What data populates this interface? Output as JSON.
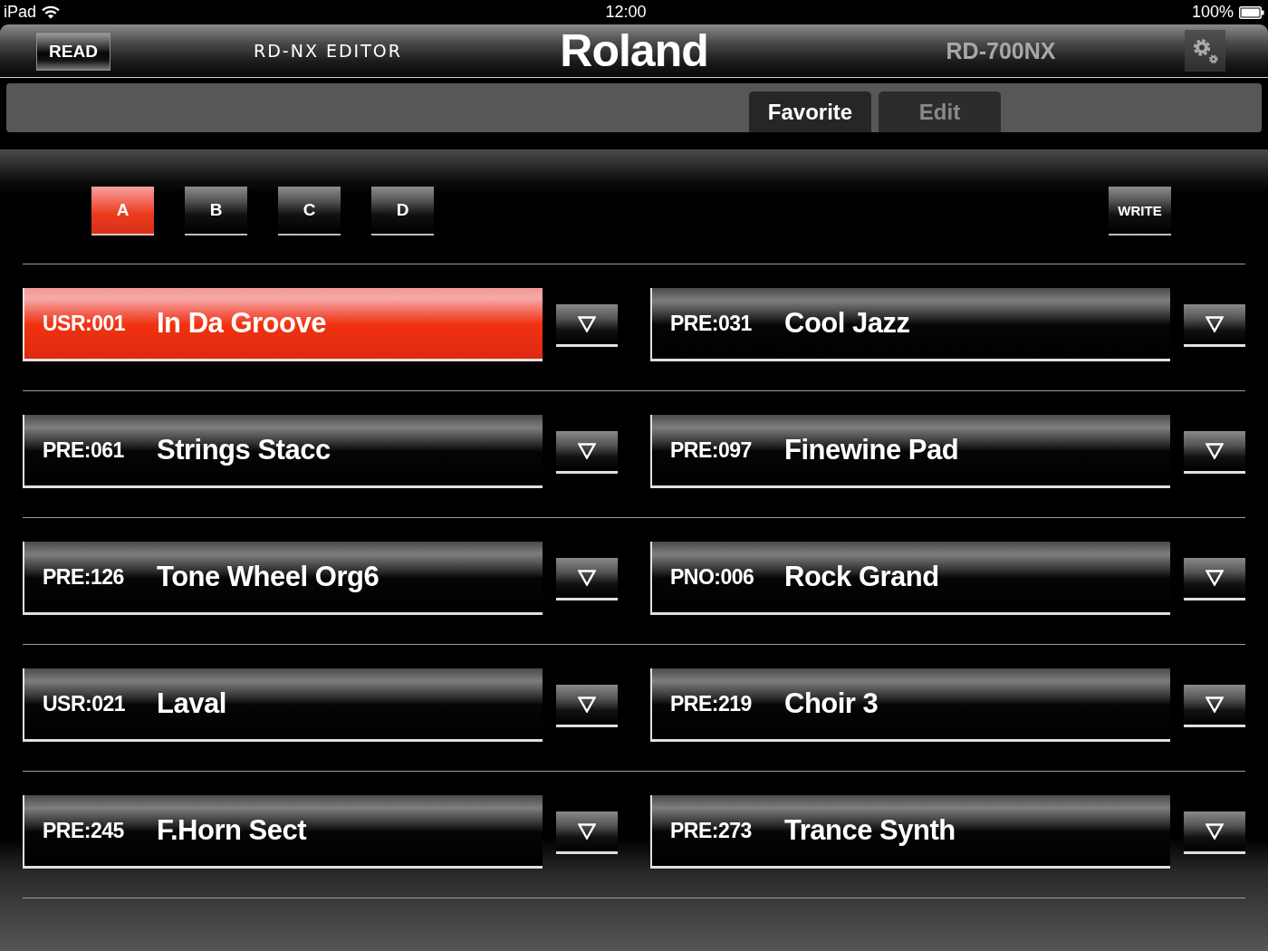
{
  "status_bar": {
    "device": "iPad",
    "time": "12:00",
    "battery": "100%"
  },
  "header": {
    "read_button": "READ",
    "app_title": "RD-NX EDITOR",
    "logo": "Roland",
    "model": "RD-700NX"
  },
  "tabs": [
    {
      "label": "Favorite",
      "selected": true
    },
    {
      "label": "Edit",
      "selected": false
    }
  ],
  "banks": [
    {
      "label": "A",
      "selected": true
    },
    {
      "label": "B",
      "selected": false
    },
    {
      "label": "C",
      "selected": false
    },
    {
      "label": "D",
      "selected": false
    }
  ],
  "write_button": "WRITE",
  "favorites": [
    {
      "number": "USR:001",
      "name": "In Da Groove",
      "selected": true
    },
    {
      "number": "PRE:031",
      "name": "Cool Jazz",
      "selected": false
    },
    {
      "number": "PRE:061",
      "name": "Strings Stacc",
      "selected": false
    },
    {
      "number": "PRE:097",
      "name": "Finewine Pad",
      "selected": false
    },
    {
      "number": "PRE:126",
      "name": "Tone Wheel Org6",
      "selected": false
    },
    {
      "number": "PNO:006",
      "name": "Rock Grand",
      "selected": false
    },
    {
      "number": "USR:021",
      "name": "Laval",
      "selected": false
    },
    {
      "number": "PRE:219",
      "name": "Choir 3",
      "selected": false
    },
    {
      "number": "PRE:245",
      "name": "F.Horn Sect",
      "selected": false
    },
    {
      "number": "PRE:273",
      "name": "Trance Synth",
      "selected": false
    }
  ]
}
